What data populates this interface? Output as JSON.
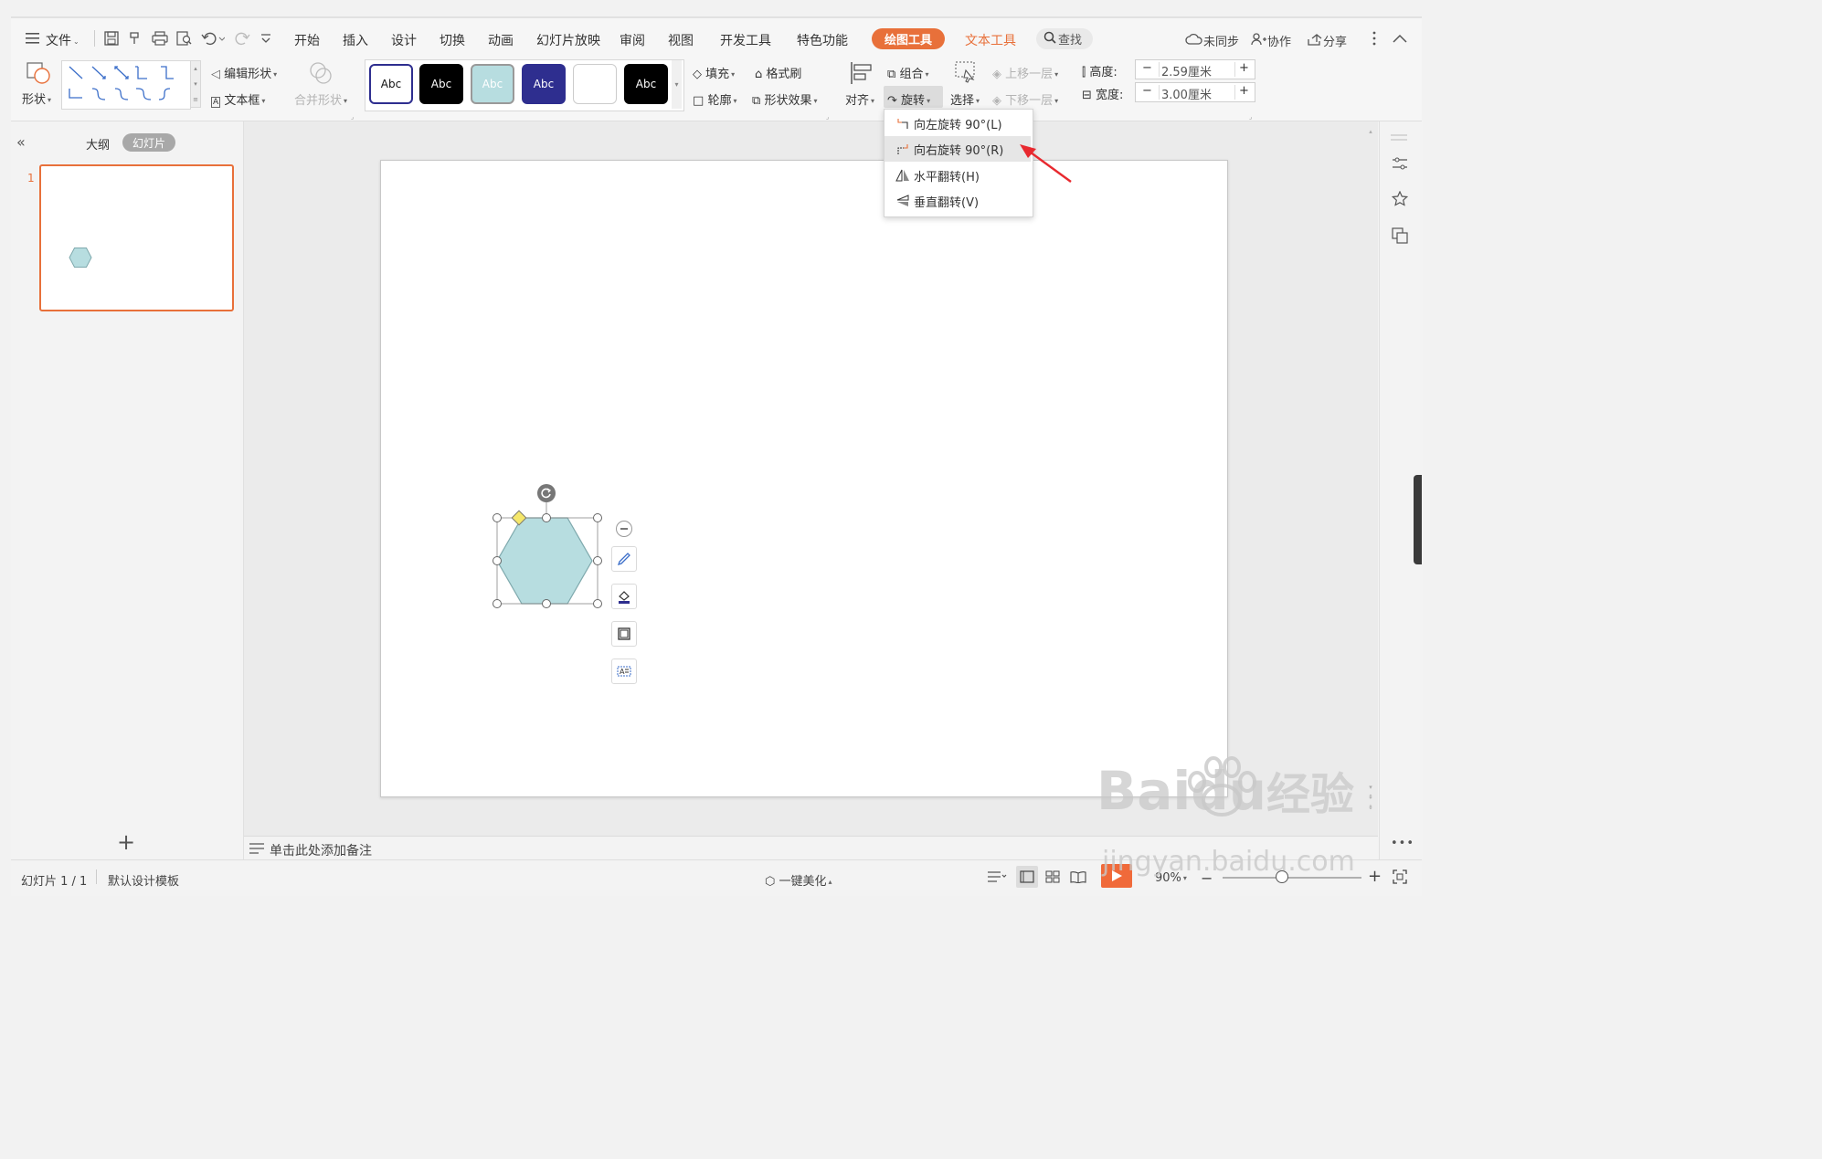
{
  "titlebar": {
    "menu_label": "文件",
    "tabs": [
      "开始",
      "插入",
      "设计",
      "切换",
      "动画",
      "幻灯片放映",
      "审阅",
      "视图",
      "开发工具",
      "特色功能"
    ],
    "active_tab": "绘图工具",
    "text_tools_tab": "文本工具",
    "search_label": "查找",
    "sync_label": "未同步",
    "collab_label": "协作",
    "share_label": "分享"
  },
  "ribbon": {
    "shape_label": "形状",
    "edit_shape": "编辑形状",
    "textbox": "文本框",
    "merge_shape": "合并形状",
    "style_samples": [
      "Abc",
      "Abc",
      "Abc",
      "Abc",
      "",
      "Abc"
    ],
    "fill": "填充",
    "format_painter": "格式刷",
    "outline": "轮廓",
    "shape_effects": "形状效果",
    "align": "对齐",
    "group": "组合",
    "rotate": "旋转",
    "select": "选择",
    "bring_forward": "上移一层",
    "send_backward": "下移一层",
    "height_label": "高度:",
    "height_value": "2.59厘米",
    "width_label": "宽度:",
    "width_value": "3.00厘米",
    "minus": "−",
    "plus": "+"
  },
  "rotate_menu": {
    "items": [
      {
        "label": "向左旋转 90°(L)",
        "icon": "rotate-left-icon"
      },
      {
        "label": "向右旋转 90°(R)",
        "icon": "rotate-right-icon"
      },
      {
        "label": "水平翻转(H)",
        "icon": "flip-horizontal-icon"
      },
      {
        "label": "垂直翻转(V)",
        "icon": "flip-vertical-icon"
      }
    ],
    "highlighted_index": 1
  },
  "left_panel": {
    "outline_tab": "大纲",
    "slides_tab": "幻灯片",
    "slide_number": "1",
    "add_slide": "+"
  },
  "notes": {
    "placeholder": "单击此处添加备注"
  },
  "statusbar": {
    "slide_info": "幻灯片 1 / 1",
    "template": "默认设计模板",
    "beautify": "一键美化",
    "zoom": "90%"
  },
  "watermark": {
    "brand": "Baidu",
    "brand_cn": "经验",
    "url": "jingyan.baidu.com"
  },
  "colors": {
    "accent": "#e8703a",
    "text_tool_accent": "#e8703a",
    "shape_fill": "#b7dde0",
    "shape_stroke": "#7fa9ad",
    "arrow": "#e8292f",
    "style_dark_blue": "#2e2e8f",
    "style_light_blue": "#b7dde0",
    "play_button": "#f06a3a"
  }
}
